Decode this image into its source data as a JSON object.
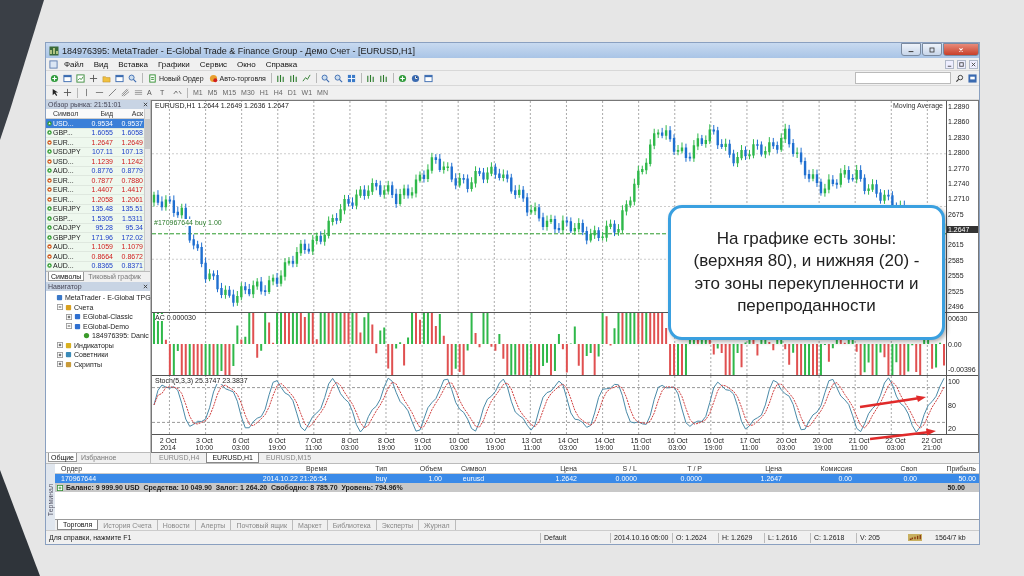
{
  "window": {
    "title": "184976395: MetaTrader - E-Global Trade & Finance Group - Демо Счет - [EURUSD,H1]"
  },
  "menu": [
    "Файл",
    "Вид",
    "Вставка",
    "Графики",
    "Сервис",
    "Окно",
    "Справка"
  ],
  "toolbar": {
    "new_order": "Новый Ордер",
    "auto_trading": "Авто-торговля"
  },
  "drawing_tools": [
    "A",
    "T"
  ],
  "timeframes": [
    "M1",
    "M5",
    "M15",
    "M30",
    "H1",
    "H4",
    "D1",
    "W1",
    "MN"
  ],
  "market_watch": {
    "title": "Обзор рынка: 21:51:01",
    "columns": [
      "Символ",
      "Бид",
      "Аск"
    ],
    "rows": [
      {
        "symbol": "USD...",
        "bid": "0.9534",
        "ask": "0.9537",
        "rising": true,
        "selected": true
      },
      {
        "symbol": "GBP...",
        "bid": "1.6055",
        "ask": "1.6058",
        "rising": true,
        "selected": false
      },
      {
        "symbol": "EUR...",
        "bid": "1.2647",
        "ask": "1.2649",
        "rising": false,
        "selected": false
      },
      {
        "symbol": "USDJPY",
        "bid": "107.11",
        "ask": "107.13",
        "rising": true,
        "selected": false
      },
      {
        "symbol": "USD...",
        "bid": "1.1239",
        "ask": "1.1242",
        "rising": false,
        "selected": false
      },
      {
        "symbol": "AUD...",
        "bid": "0.8776",
        "ask": "0.8779",
        "rising": true,
        "selected": false
      },
      {
        "symbol": "EUR...",
        "bid": "0.7877",
        "ask": "0.7880",
        "rising": false,
        "selected": false
      },
      {
        "symbol": "EUR...",
        "bid": "1.4407",
        "ask": "1.4417",
        "rising": false,
        "selected": false
      },
      {
        "symbol": "EUR...",
        "bid": "1.2058",
        "ask": "1.2061",
        "rising": false,
        "selected": false
      },
      {
        "symbol": "EURJPY",
        "bid": "135.48",
        "ask": "135.51",
        "rising": true,
        "selected": false
      },
      {
        "symbol": "GBP...",
        "bid": "1.5305",
        "ask": "1.5311",
        "rising": true,
        "selected": false
      },
      {
        "symbol": "CADJPY",
        "bid": "95.28",
        "ask": "95.34",
        "rising": true,
        "selected": false
      },
      {
        "symbol": "GBPJPY",
        "bid": "171.96",
        "ask": "172.02",
        "rising": true,
        "selected": false
      },
      {
        "symbol": "AUD...",
        "bid": "1.1059",
        "ask": "1.1079",
        "rising": false,
        "selected": false
      },
      {
        "symbol": "AUD...",
        "bid": "0.8664",
        "ask": "0.8672",
        "rising": false,
        "selected": false
      },
      {
        "symbol": "AUD...",
        "bid": "0.8365",
        "ask": "0.8371",
        "rising": true,
        "selected": false
      }
    ],
    "tabs": [
      {
        "label": "Символы",
        "selected": true
      },
      {
        "label": "Тиковый график",
        "selected": false
      }
    ]
  },
  "navigator": {
    "title": "Навигатор",
    "tree": [
      {
        "label": "MetaTrader - E-Global TPG",
        "kind": "terminal",
        "children": [
          {
            "label": "Счета",
            "kind": "accounts",
            "expanded": true,
            "children": [
              {
                "label": "EGlobal-Classic",
                "kind": "server",
                "expanded": false
              },
              {
                "label": "EGlobal-Demo",
                "kind": "server",
                "expanded": true,
                "children": [
                  {
                    "label": "184976395: Danic",
                    "kind": "account"
                  }
                ]
              }
            ]
          },
          {
            "label": "Индикаторы",
            "kind": "indicators",
            "expanded": false
          },
          {
            "label": "Советники",
            "kind": "experts",
            "expanded": false
          },
          {
            "label": "Скрипты",
            "kind": "scripts",
            "expanded": false
          }
        ]
      }
    ],
    "tabs": [
      {
        "label": "Общие",
        "selected": true
      },
      {
        "label": "Избранное",
        "selected": false
      }
    ]
  },
  "chart": {
    "header": "EURUSD,H1  1.2644 1.2649 1.2636 1.2647",
    "indicator": "Moving Average",
    "order_line": "#170967644 buy 1.00",
    "price_axis": [
      {
        "label": "1.2890",
        "kind": "tick"
      },
      {
        "label": "1.2860",
        "kind": "tick"
      },
      {
        "label": "1.2830",
        "kind": "tick"
      },
      {
        "label": "1.2800",
        "kind": "tick"
      },
      {
        "label": "1.2770",
        "kind": "tick"
      },
      {
        "label": "1.2740",
        "kind": "tick"
      },
      {
        "label": "1.2710",
        "kind": "tick"
      },
      {
        "label": "2675",
        "kind": "tick"
      },
      {
        "label": "1.2647",
        "kind": "current"
      },
      {
        "label": "2615",
        "kind": "tick"
      },
      {
        "label": "2585",
        "kind": "tick"
      },
      {
        "label": "2555",
        "kind": "tick"
      },
      {
        "label": "2525",
        "kind": "tick"
      },
      {
        "label": "2496",
        "kind": "tick"
      }
    ],
    "ac": {
      "label": "AC 0.000030",
      "axis": [
        "00630",
        "0.00",
        "-0.00396"
      ]
    },
    "stoch": {
      "label": "Stoch(5,3,3) 25.3747 23.3837",
      "axis": [
        "100",
        "80",
        "20"
      ]
    },
    "time_axis": [
      "2 Oct 2014",
      "3 Oct 10:00",
      "6 Oct 03:00",
      "6 Oct 19:00",
      "7 Oct 11:00",
      "8 Oct 03:00",
      "8 Oct 19:00",
      "9 Oct 11:00",
      "10 Oct 03:00",
      "10 Oct 19:00",
      "13 Oct 11:00",
      "14 Oct 03:00",
      "14 Oct 19:00",
      "15 Oct 11:00",
      "16 Oct 03:00",
      "16 Oct 19:00",
      "17 Oct 11:00",
      "20 Oct 03:00",
      "20 Oct 19:00",
      "21 Oct 11:00",
      "22 Oct 03:00",
      "22 Oct 21:00"
    ]
  },
  "chart_tabs": [
    {
      "label": "EURUSD,H4",
      "selected": false
    },
    {
      "label": "EURUSD,H1",
      "selected": true
    },
    {
      "label": "EURUSD,M15",
      "selected": false
    }
  ],
  "terminal": {
    "side_label": "Терминал",
    "columns": [
      "Ордер",
      "Время",
      "Тип",
      "Объем",
      "Символ",
      "Цена",
      "S / L",
      "T / P",
      "Цена",
      "Комиссия",
      "Своп",
      "Прибыль"
    ],
    "orders": [
      {
        "cells": [
          "170967644",
          "2014.10.22 21:26:54",
          "buy",
          "1.00",
          "eurusd",
          "1.2642",
          "0.0000",
          "0.0000",
          "1.2647",
          "0.00",
          "0.00",
          "50.00"
        ],
        "selected": true
      }
    ],
    "balance": "Баланс: 9 999.90 USD  Средства: 10 049.90  Залог: 1 264.20  Свободно: 8 785.70  Уровень: 794.96%",
    "total": "50.00",
    "tabs": [
      {
        "label": "Торговля",
        "selected": true
      },
      {
        "label": "История Счета",
        "selected": false
      },
      {
        "label": "Новости",
        "selected": false
      },
      {
        "label": "Алерты",
        "selected": false
      },
      {
        "label": "Почтовый ящик",
        "selected": false
      },
      {
        "label": "Маркет",
        "selected": false
      },
      {
        "label": "Библиотека",
        "selected": false
      },
      {
        "label": "Эксперты",
        "selected": false
      },
      {
        "label": "Журнал",
        "selected": false
      }
    ]
  },
  "status_bar": {
    "help": "Для справки, нажмите F1",
    "fields": [
      "Default",
      "2014.10.16 05:00",
      "O: 1.2624",
      "H: 1.2629",
      "L: 1.2616",
      "C: 1.2618",
      "V: 205"
    ],
    "traffic": "1564/7 kb"
  },
  "callout": "На графике есть зоны: (верхняя 80), и нижняя (20) - это зоны перекупленности и перепроданности"
}
